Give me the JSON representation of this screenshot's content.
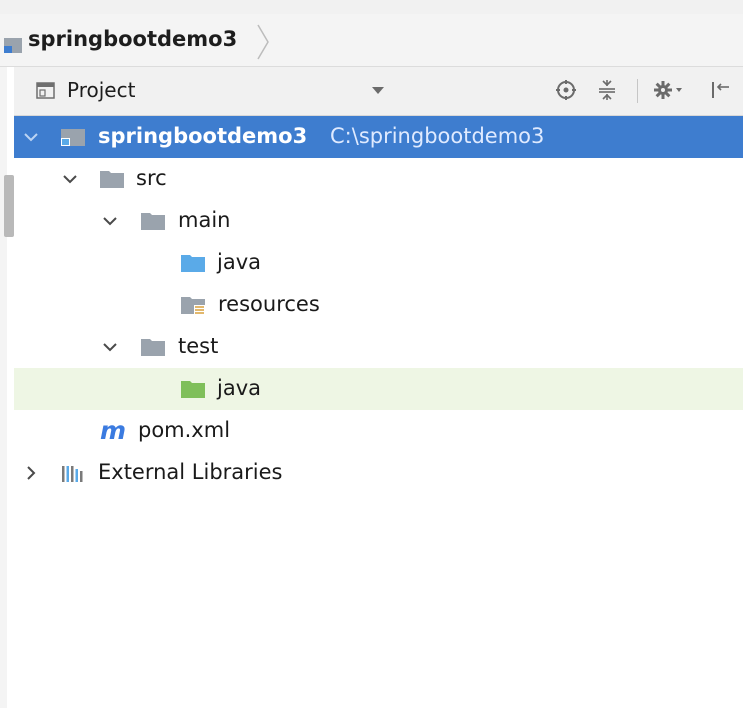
{
  "breadcrumb": {
    "project": "springbootdemo3"
  },
  "panel": {
    "title": "Project"
  },
  "toolbar": {
    "icons": [
      "locate-icon",
      "collapse-all-icon",
      "settings-icon",
      "hide-panel-icon"
    ]
  },
  "tree": {
    "root": {
      "name": "springbootdemo3",
      "path": "C:\\springbootdemo3"
    },
    "src": "src",
    "main": "main",
    "main_java": "java",
    "resources": "resources",
    "test": "test",
    "test_java": "java",
    "pom": "pom.xml",
    "external": "External Libraries"
  },
  "colors": {
    "selection": "#3e7dcf",
    "source_folder": "#5aaae8",
    "test_folder": "#7fbf5a",
    "plain_folder": "#9aa3ad",
    "maven": "#3b7be0",
    "hover_row": "#eef6e4"
  }
}
